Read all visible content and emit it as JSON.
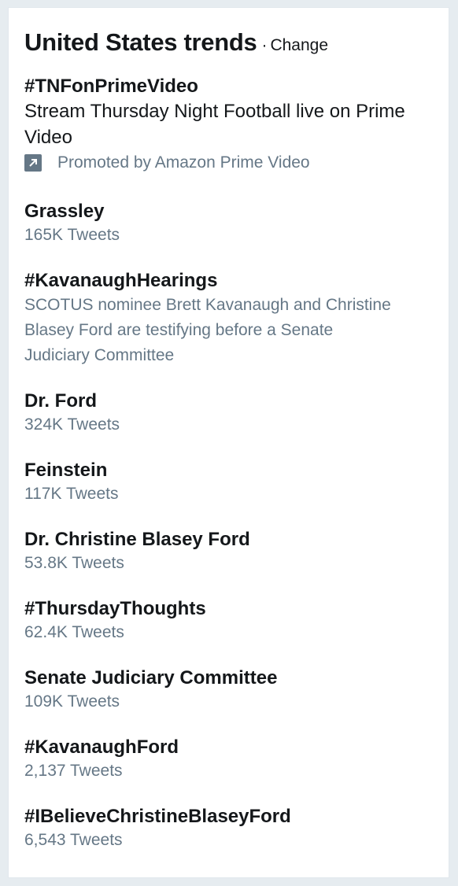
{
  "header": {
    "title": "United States trends",
    "separator": "·",
    "change_label": "Change"
  },
  "promoted_trend": {
    "name": "#TNFonPrimeVideo",
    "description": "Stream Thursday Night Football live on Prime Video",
    "promoted_by": "Promoted by Amazon Prime Video",
    "icon": "promoted-arrow-icon"
  },
  "trends": [
    {
      "name": "Grassley",
      "count": "165K Tweets"
    },
    {
      "name": "#KavanaughHearings",
      "description": "SCOTUS nominee Brett Kavanaugh and Christine Blasey Ford are testifying before a Senate Judiciary Committee"
    },
    {
      "name": "Dr. Ford",
      "count": "324K Tweets"
    },
    {
      "name": "Feinstein",
      "count": "117K Tweets"
    },
    {
      "name": "Dr. Christine Blasey Ford",
      "count": "53.8K Tweets"
    },
    {
      "name": "#ThursdayThoughts",
      "count": "62.4K Tweets"
    },
    {
      "name": "Senate Judiciary Committee",
      "count": "109K Tweets"
    },
    {
      "name": "#KavanaughFord",
      "count": "2,137 Tweets"
    },
    {
      "name": "#IBelieveChristineBlaseyFord",
      "count": "6,543 Tweets"
    }
  ],
  "colors": {
    "text_primary": "#14171a",
    "text_secondary": "#657786",
    "background": "#e6ecf0",
    "panel": "#ffffff"
  }
}
